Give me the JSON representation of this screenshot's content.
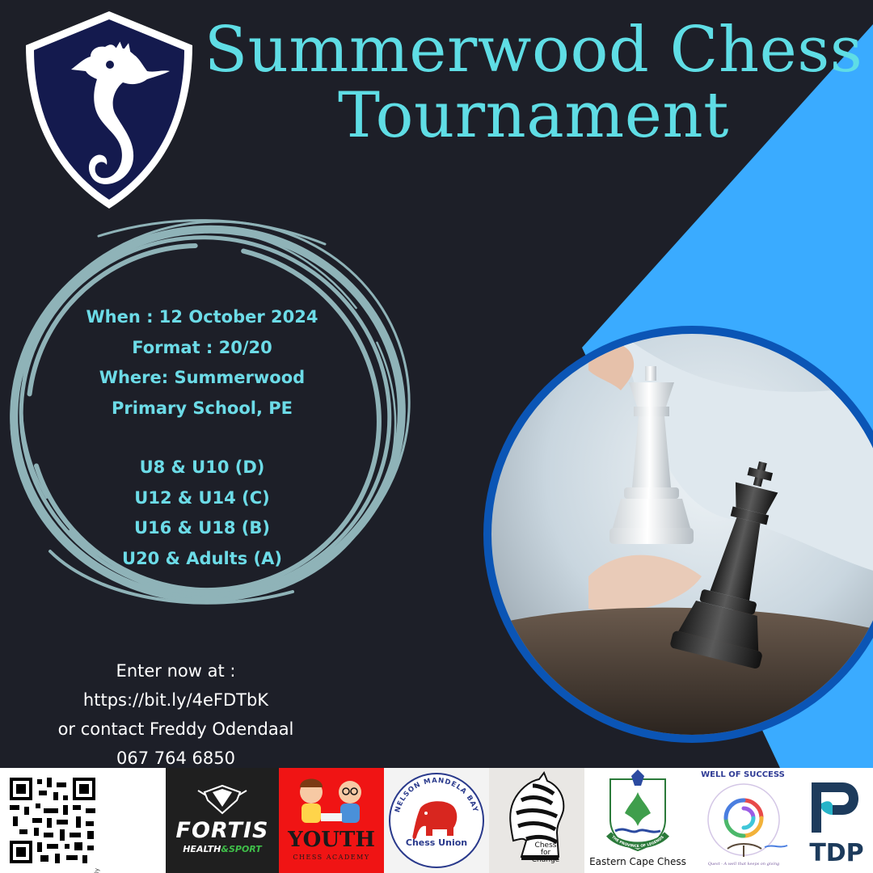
{
  "poster": {
    "title_line1": "Summerwood Chess",
    "title_line2": "Tournament",
    "details": {
      "when": "When : 12 October 2024",
      "format": "Format : 20/20",
      "where_line1": "Where: Summerwood",
      "where_line2": "Primary School, PE",
      "divisions": [
        "U8 & U10 (D)",
        "U12 & U14 (C)",
        "U16 & U18 (B)",
        "U20 & Adults (A)"
      ]
    },
    "enter": {
      "line1": "Enter now at :",
      "url": "https://bit.ly/4eFDTbK",
      "line3": "or contact Freddy Odendaal",
      "phone": "067 764 6850"
    }
  },
  "sponsors": {
    "qr_tag": "bitly",
    "fortis_name": "FORTIS",
    "fortis_sub_left": "HEALTH",
    "fortis_sub_right": "SPORT",
    "youth_name": "YOUTH",
    "youth_sub": "CHESS ACADEMY",
    "nmb_ring": "NELSON MANDELA BAY",
    "nmb_name": "Chess Union",
    "cfc_line1": "Chess",
    "cfc_line2": "for",
    "cfc_line3": "Change",
    "ecc_ring": "THE PROVINCE OF LEGENDS",
    "ecc_name": "Eastern Cape Chess",
    "wos_title": "WELL OF SUCCESS",
    "wos_tag": "Quest - A well that keeps on giving",
    "tdp_name": "TDP"
  },
  "colors": {
    "background": "#1d1f28",
    "accent_blue": "#3aabff",
    "title_cyan": "#5fdde5",
    "details_cyan": "#6cdbe7",
    "ring_blue": "#0b55b5",
    "crest_navy": "#141a4e"
  },
  "icons": {
    "crest": "seahorse-shield-icon",
    "swirl": "brush-circle-swirl",
    "photo": "chess-kings-photo"
  }
}
